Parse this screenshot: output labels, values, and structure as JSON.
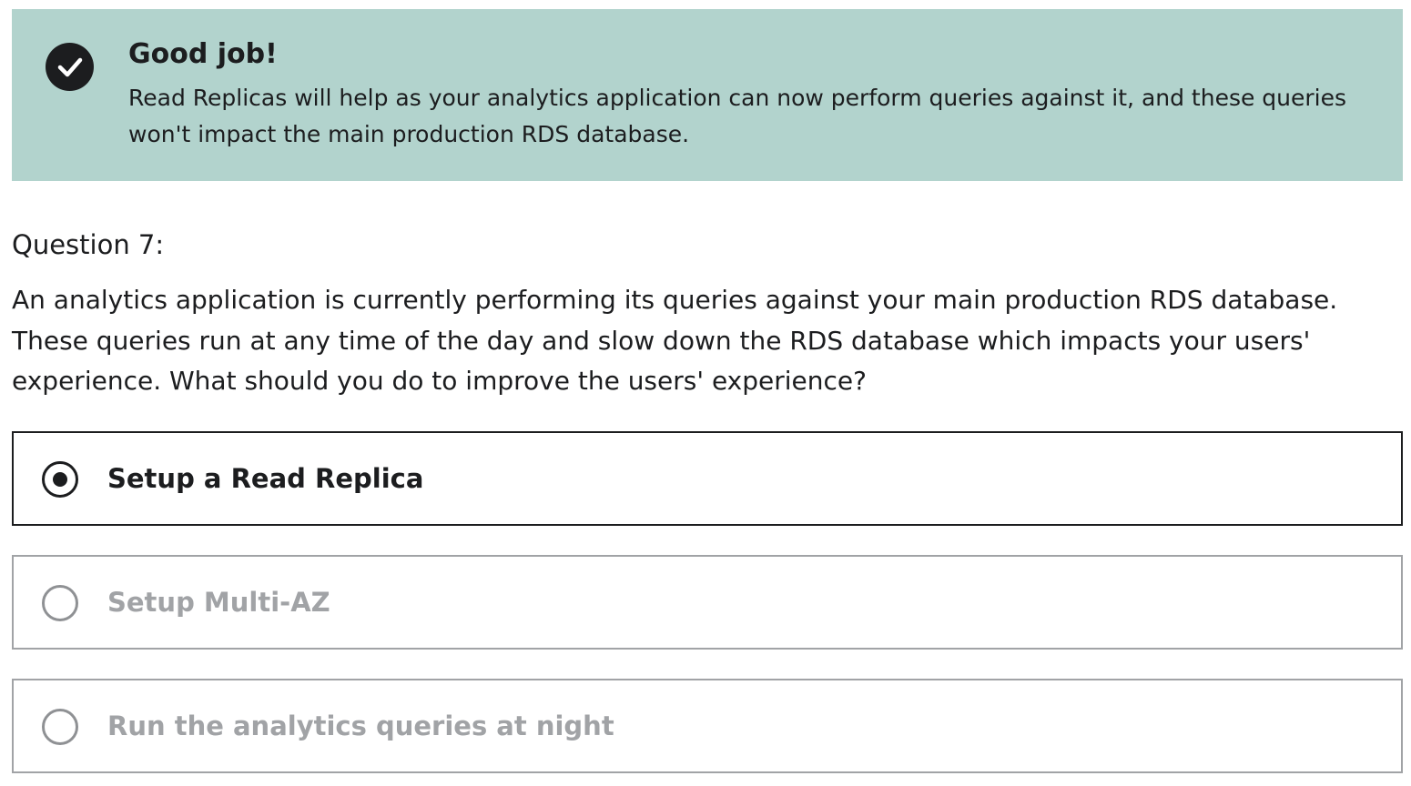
{
  "feedback": {
    "icon": "check-circle-icon",
    "title": "Good job!",
    "message": "Read Replicas will help as your analytics application can now perform queries against it, and these queries won't impact the main production RDS database."
  },
  "question": {
    "label": "Question 7:",
    "text": "An analytics application is currently performing its queries against your main production RDS database. These queries run at any time of the day and slow down the RDS database which impacts your users' experience. What should you do to improve the users' experience?"
  },
  "options": [
    {
      "label": "Setup a Read Replica",
      "selected": true
    },
    {
      "label": "Setup Multi-AZ",
      "selected": false
    },
    {
      "label": "Run the analytics queries at night",
      "selected": false
    }
  ],
  "colors": {
    "banner_bg": "#b2d3cd",
    "text": "#1c1d1f",
    "muted": "#a1a3a6"
  }
}
